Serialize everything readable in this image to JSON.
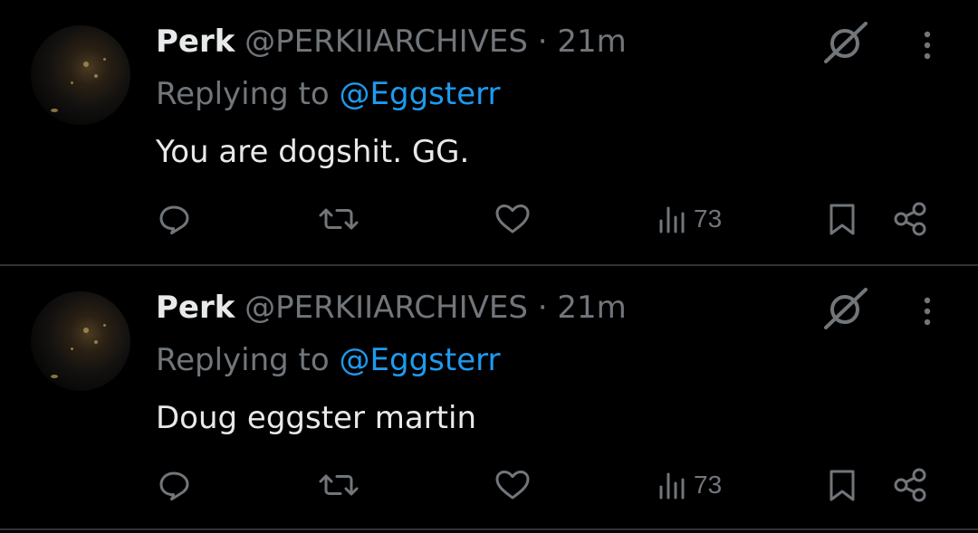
{
  "tweets": [
    {
      "author_name": "Perk",
      "handle": "@PERKIIARCHIVES",
      "separator": "·",
      "time": "21m",
      "replying_prefix": "Replying to",
      "replying_to": "@Eggsterr",
      "text": "You are dogshit. GG.",
      "views": "73"
    },
    {
      "author_name": "Perk",
      "handle": "@PERKIIARCHIVES",
      "separator": "·",
      "time": "21m",
      "replying_prefix": "Replying to",
      "replying_to": "@Eggsterr",
      "text": "Doug eggster martin",
      "views": "73"
    }
  ],
  "icons": {
    "reply": "reply-icon",
    "retweet": "retweet-icon",
    "like": "heart-icon",
    "views": "views-icon",
    "bookmark": "bookmark-icon",
    "share": "share-icon",
    "grok": "grok-icon",
    "more": "more-icon"
  },
  "colors": {
    "background": "#000000",
    "text_primary": "#e7e9ea",
    "text_secondary": "#71767b",
    "accent": "#1d9bf0",
    "divider": "#2f3336"
  }
}
